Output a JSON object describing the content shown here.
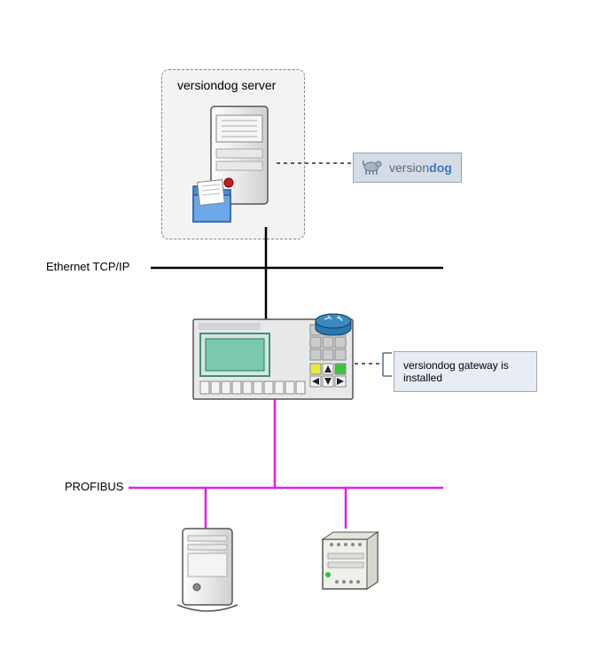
{
  "diagram": {
    "server_label": "versiondog server",
    "ethernet_label": "Ethernet TCP/IP",
    "profibus_label": "PROFIBUS",
    "logo_text_1": "version",
    "logo_text_2": "dog",
    "callout_gateway": "versiondog gateway is installed"
  },
  "nodes": {
    "server": {
      "type": "server-with-folder"
    },
    "hmi_panel": {
      "type": "hmi-panel"
    },
    "router": {
      "type": "router"
    },
    "device_left": {
      "type": "tower-device"
    },
    "device_right": {
      "type": "plc-module"
    }
  },
  "connections": {
    "ethernet_bus": {
      "color": "black"
    },
    "profibus_bus": {
      "color": "magenta"
    }
  }
}
